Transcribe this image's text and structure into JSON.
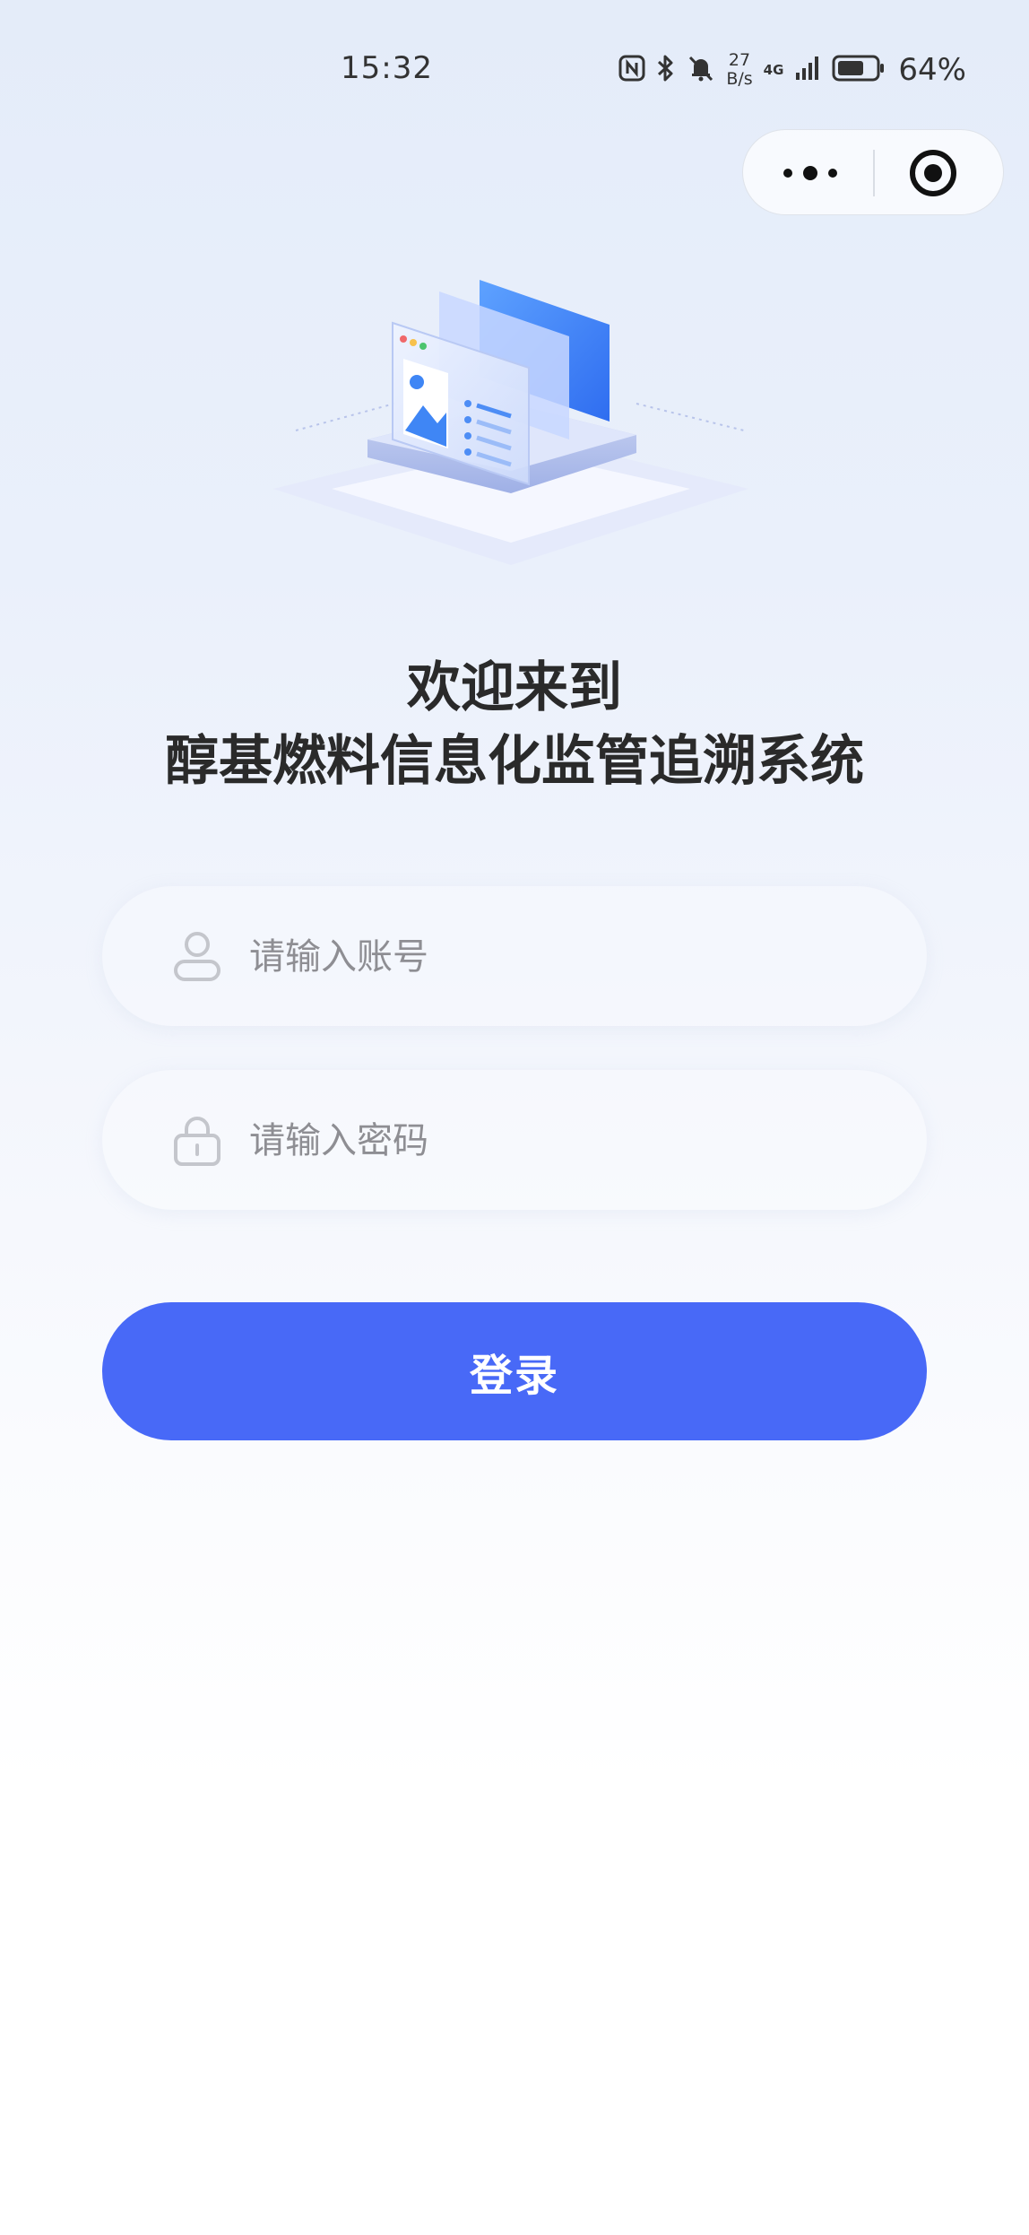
{
  "status_bar": {
    "time": "15:32",
    "net_speed_value": "27",
    "net_speed_unit": "B/s",
    "network_type": "4G",
    "battery_percent": "64%",
    "icons": [
      "nfc-icon",
      "bluetooth-icon",
      "mute-bell-icon",
      "signal-icon",
      "battery-icon"
    ]
  },
  "capsule": {
    "icons": [
      "more-dots-icon",
      "close-target-icon"
    ]
  },
  "welcome": {
    "line1": "欢迎来到",
    "line2": "醇基燃料信息化监管追溯系统"
  },
  "form": {
    "account_placeholder": "请输入账号",
    "password_placeholder": "请输入密码",
    "login_label": "登录"
  },
  "colors": {
    "primary": "#4869f7",
    "accent_blue": "#3c7cf0"
  }
}
